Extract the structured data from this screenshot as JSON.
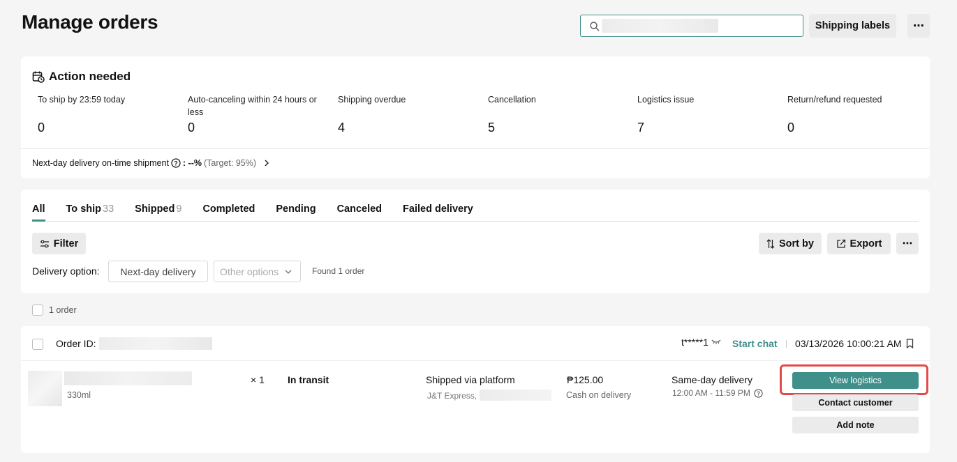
{
  "page": {
    "title": "Manage orders"
  },
  "header": {
    "search_placeholder": "",
    "shipping_labels": "Shipping labels",
    "more": "⋯"
  },
  "action_needed": {
    "title": "Action needed",
    "metrics": [
      {
        "label": "To ship by 23:59 today",
        "value": "0"
      },
      {
        "label": "Auto-canceling within 24 hours or less",
        "value": "0"
      },
      {
        "label": "Shipping overdue",
        "value": "4"
      },
      {
        "label": "Cancellation",
        "value": "5"
      },
      {
        "label": "Logistics issue",
        "value": "7"
      },
      {
        "label": "Return/refund requested",
        "value": "0"
      }
    ],
    "next_day_label": "Next-day delivery on-time shipment",
    "next_day_value": ": --%",
    "next_day_target": "(Target: 95%)"
  },
  "tabs": [
    {
      "label": "All",
      "count": ""
    },
    {
      "label": "To ship",
      "count": "33"
    },
    {
      "label": "Shipped",
      "count": "9"
    },
    {
      "label": "Completed",
      "count": ""
    },
    {
      "label": "Pending",
      "count": ""
    },
    {
      "label": "Canceled",
      "count": ""
    },
    {
      "label": "Failed delivery",
      "count": ""
    }
  ],
  "toolbar": {
    "filter": "Filter",
    "sort_by": "Sort by",
    "export": "Export",
    "more": "⋯"
  },
  "delivery": {
    "label": "Delivery option:",
    "selected": "Next-day delivery",
    "other": "Other options",
    "found": "Found 1 order"
  },
  "selection": {
    "count_label": "1 order"
  },
  "order": {
    "id_label": "Order ID:",
    "buyer": "t*****1",
    "start_chat": "Start chat",
    "date": "03/13/2026 10:00:21 AM",
    "variant": "330ml",
    "qty": "× 1",
    "status": "In transit",
    "shipping_method": "Shipped via platform",
    "carrier": "J&T Express, ",
    "price": "₱125.00",
    "payment": "Cash on delivery",
    "delivery_type": "Same-day delivery",
    "delivery_window": "12:00 AM - 11:59 PM",
    "actions": {
      "view_logistics": "View logistics",
      "contact_customer": "Contact customer",
      "add_note": "Add note"
    }
  },
  "colors": {
    "accent": "#3f8f8a",
    "highlight": "#e24a4a"
  }
}
